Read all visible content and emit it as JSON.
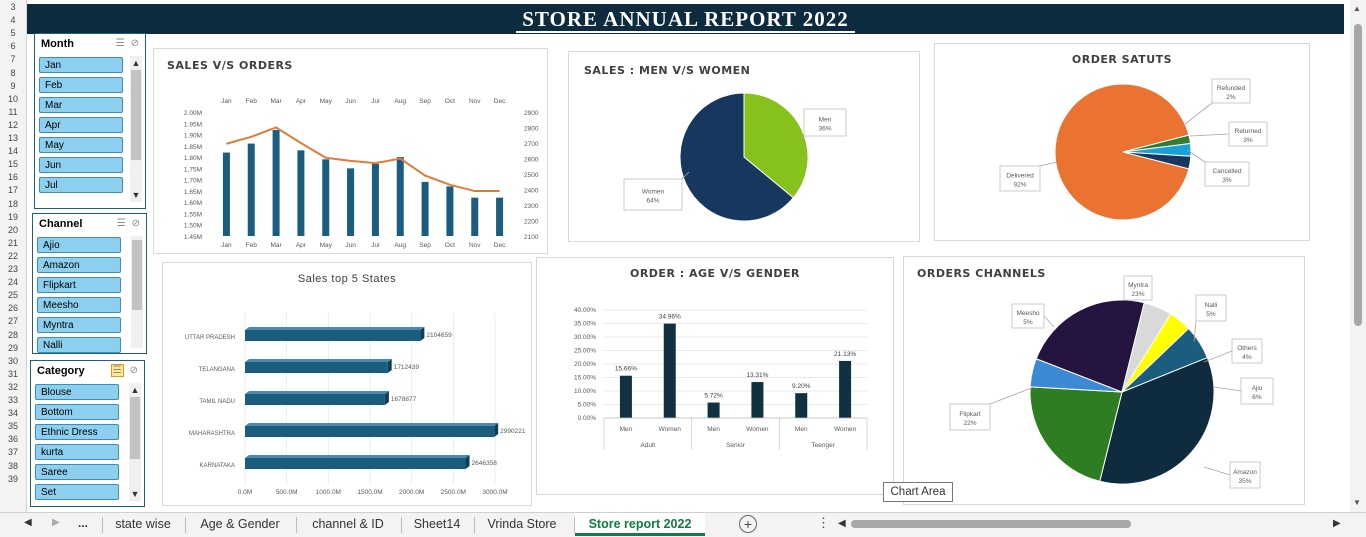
{
  "banner": {
    "title": "STORE ANNUAL REPORT  2022"
  },
  "rows": [
    "3",
    "4",
    "5",
    "6",
    "7",
    "8",
    "9",
    "10",
    "11",
    "12",
    "13",
    "14",
    "15",
    "16",
    "17",
    "18",
    "19",
    "20",
    "21",
    "22",
    "23",
    "24",
    "25",
    "26",
    "27",
    "28",
    "29",
    "30",
    "31",
    "32",
    "33",
    "34",
    "35",
    "36",
    "37",
    "38",
    "39"
  ],
  "slicers": {
    "month": {
      "title": "Month",
      "items": [
        "Jan",
        "Feb",
        "Mar",
        "Apr",
        "May",
        "Jun",
        "Jul"
      ]
    },
    "channel": {
      "title": "Channel",
      "items": [
        "Ajio",
        "Amazon",
        "Flipkart",
        "Meesho",
        "Myntra",
        "Nalli"
      ]
    },
    "category": {
      "title": "Category",
      "items": [
        "Blouse",
        "Bottom",
        "Ethnic Dress",
        "kurta",
        "Saree",
        "Set"
      ]
    }
  },
  "charts": {
    "sales_orders": {
      "title": "SALES V/S ORDERS",
      "type": "bar+line",
      "categories": [
        "Jan",
        "Feb",
        "Mar",
        "Apr",
        "May",
        "Jun",
        "Jul",
        "Aug",
        "Sep",
        "Oct",
        "Nov",
        "Dec"
      ],
      "left_axis": {
        "ticks": [
          "2.00M",
          "1.95M",
          "1.90M",
          "1.85M",
          "1.80M",
          "1.75M",
          "1.70M",
          "1.65M",
          "1.60M",
          "1.55M",
          "1.50M",
          "1.45M"
        ],
        "ylim": [
          1.45,
          2.0
        ]
      },
      "right_axis": {
        "ticks": [
          "2900",
          "2800",
          "2700",
          "2600",
          "2500",
          "2400",
          "2300",
          "2200",
          "2100"
        ],
        "ylim": [
          2100,
          2900
        ]
      },
      "bars": [
        1.82,
        1.86,
        1.92,
        1.83,
        1.79,
        1.75,
        1.77,
        1.8,
        1.69,
        1.67,
        1.62,
        1.62
      ],
      "line": [
        2695,
        2740,
        2800,
        2700,
        2605,
        2585,
        2570,
        2600,
        2490,
        2430,
        2390,
        2390
      ],
      "colors": {
        "bar": "#1b5d7e",
        "line": "#e07b39"
      }
    },
    "sales_gender": {
      "title": "SALES : MEN V/S WOMEN",
      "type": "pie",
      "slices": [
        {
          "label": "Men",
          "pct_label": "36%",
          "value": 36,
          "color": "#86c11c"
        },
        {
          "label": "Women",
          "pct_label": "64%",
          "value": 64,
          "color": "#17375e"
        }
      ]
    },
    "order_status": {
      "title": "ORDER SATUTS",
      "type": "pie",
      "slices": [
        {
          "label": "Delivered",
          "pct_label": "92%",
          "value": 92,
          "color": "#ea7332"
        },
        {
          "label": "Refunded",
          "pct_label": "2%",
          "value": 2,
          "color": "#2e7d32"
        },
        {
          "label": "Returned",
          "pct_label": "3%",
          "value": 3,
          "color": "#1a9fd6"
        },
        {
          "label": "Cancelled",
          "pct_label": "3%",
          "value": 3,
          "color": "#17375e"
        }
      ]
    },
    "top_states": {
      "title": "Sales top 5 States",
      "type": "bar",
      "categories": [
        "UTTAR PRADESH",
        "TELANGANA",
        "TAMIL NADU",
        "MAHARASHTRA",
        "KARNATAKA"
      ],
      "values": [
        2104659,
        1712439,
        1678877,
        2990221,
        2646358
      ],
      "value_labels": [
        "2104659",
        "1712439",
        "1678877",
        "2990221",
        "2646358"
      ],
      "x_ticks": [
        "0.0M",
        "500.0M",
        "1000.0M",
        "1500.0M",
        "2000.0M",
        "2500.0M",
        "3000.0M"
      ],
      "xlim": [
        0,
        3000000
      ],
      "color": "#1b5d7e"
    },
    "age_gender": {
      "title": "ORDER : AGE V/S GENDER",
      "type": "bar",
      "y_ticks": [
        "40.00%",
        "35.00%",
        "30.00%",
        "25.00%",
        "20.00%",
        "15.00%",
        "10.00%",
        "5.00%",
        "0.00%"
      ],
      "ylim": [
        0,
        40
      ],
      "groups": [
        {
          "name": "Adult",
          "bars": [
            {
              "label": "Men",
              "value": 15.66,
              "text": "15.66%"
            },
            {
              "label": "Women",
              "value": 34.96,
              "text": "34.96%"
            }
          ]
        },
        {
          "name": "Senior",
          "bars": [
            {
              "label": "Men",
              "value": 5.72,
              "text": "5.72%"
            },
            {
              "label": "Women",
              "value": 13.31,
              "text": "13.31%"
            }
          ]
        },
        {
          "name": "Teenger",
          "bars": [
            {
              "label": "Men",
              "value": 9.2,
              "text": "9.20%"
            },
            {
              "label": "Women",
              "value": 21.13,
              "text": "21.13%"
            }
          ]
        }
      ],
      "color": "#0f3142"
    },
    "channels": {
      "title": "ORDERS CHANNELS",
      "type": "pie",
      "slices": [
        {
          "label": "Amazon",
          "pct_label": "35%",
          "value": 35,
          "color": "#0e2c3e"
        },
        {
          "label": "Flipkart",
          "pct_label": "22%",
          "value": 22,
          "color": "#2f7d23"
        },
        {
          "label": "Meesho",
          "pct_label": "5%",
          "value": 5,
          "color": "#3d8ad4"
        },
        {
          "label": "Myntra",
          "pct_label": "23%",
          "value": 23,
          "color": "#261440"
        },
        {
          "label": "Nalli",
          "pct_label": "5%",
          "value": 5,
          "color": "#d9d9d9"
        },
        {
          "label": "Others",
          "pct_label": "4%",
          "value": 4,
          "color": "#ffff00"
        },
        {
          "label": "Ajio",
          "pct_label": "6%",
          "value": 6,
          "color": "#1b5d7e"
        }
      ]
    }
  },
  "tooltip": "Chart Area",
  "tabs": [
    "state wise",
    "Age & Gender",
    "channel & ID",
    "Sheet14",
    "Vrinda Store",
    "Store report 2022"
  ],
  "tabs_overflow": "...",
  "active_tab": "Store report 2022"
}
